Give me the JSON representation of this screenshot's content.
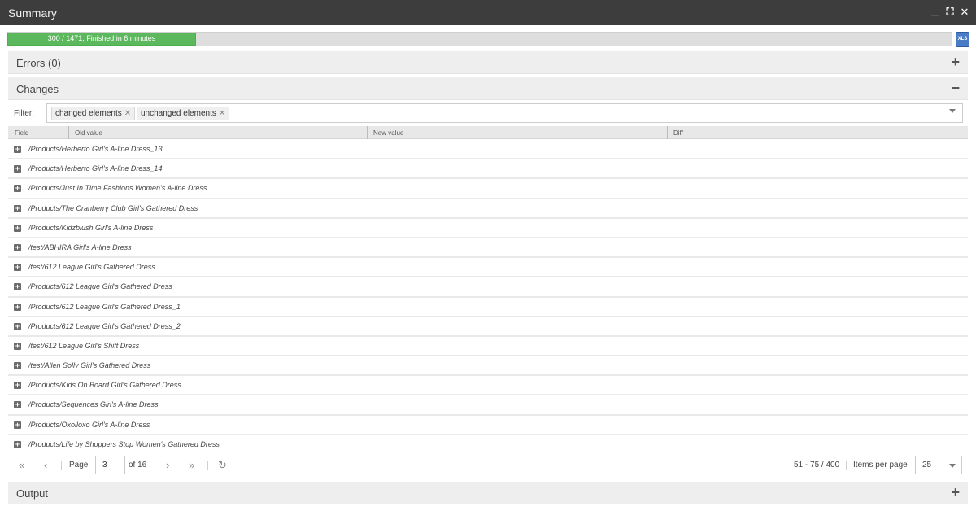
{
  "window": {
    "title": "Summary",
    "buttons": {
      "minimize": "_",
      "maximize": "⛶",
      "close": "✕"
    }
  },
  "progress": {
    "text": "300 / 1471, Finished in 6 minutes",
    "fraction": 0.2,
    "color": "#5cb85c"
  },
  "export_icon": {
    "icon": "export-icon",
    "glyph": "XLS"
  },
  "sections": {
    "errors": {
      "label": "Errors (0)",
      "toggle": "+"
    },
    "changes": {
      "label": "Changes",
      "toggle": "−"
    },
    "output": {
      "label": "Output",
      "toggle": "+"
    }
  },
  "filter": {
    "label": "Filter:",
    "chips": [
      {
        "label": "changed elements",
        "remove": "✕"
      },
      {
        "label": "unchanged elements",
        "remove": "✕"
      }
    ]
  },
  "grid": {
    "columns": [
      "Field",
      "Old value",
      "New value",
      "Diff"
    ],
    "expand_glyph": "+",
    "rows": [
      "/Products/Herberto Girl's A-line Dress_13",
      "/Products/Herberto Girl's A-line Dress_14",
      "/Products/Just In Time Fashions Women's A-line Dress",
      "/Products/The Cranberry Club Girl's Gathered Dress",
      "/Products/Kidzblush Girl's A-line Dress",
      "/test/ABHIRA Girl's A-line Dress",
      "/test/612 League Girl's Gathered Dress",
      "/Products/612 League Girl's Gathered Dress",
      "/Products/612 League Girl's Gathered Dress_1",
      "/Products/612 League Girl's Gathered Dress_2",
      "/test/612 League Girl's Shift Dress",
      "/test/Allen Solly Girl's Gathered Dress",
      "/Products/Kids On Board Girl's Gathered Dress",
      "/Products/Sequences Girl's A-line Dress",
      "/Products/Oxolloxo Girl's A-line Dress",
      "/Products/Life by Shoppers Stop Women's Gathered Dress"
    ]
  },
  "pager": {
    "first": "«",
    "prev": "‹",
    "page_label": "Page",
    "page_value": "3",
    "of_label": "of 16",
    "next": "›",
    "last": "»",
    "refresh": "↻",
    "range": "51 - 75 / 400",
    "items_per_page_label": "Items per page",
    "items_per_page": "25"
  }
}
